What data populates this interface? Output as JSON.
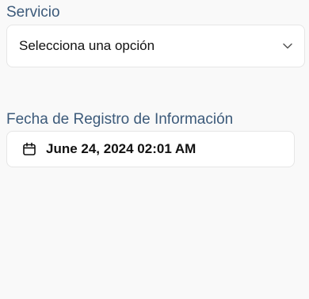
{
  "servicio": {
    "label": "Servicio",
    "selected": "Selecciona una opción",
    "icon": "chevron-down-icon"
  },
  "fecha": {
    "label": "Fecha de Registro de Información",
    "value": "June 24, 2024 02:01 AM",
    "icon": "calendar-icon"
  },
  "colors": {
    "label": "#3c5a7a",
    "background": "#f9f9f9",
    "field_background": "#ffffff",
    "border": "#e6e6e6",
    "text": "#111111"
  }
}
